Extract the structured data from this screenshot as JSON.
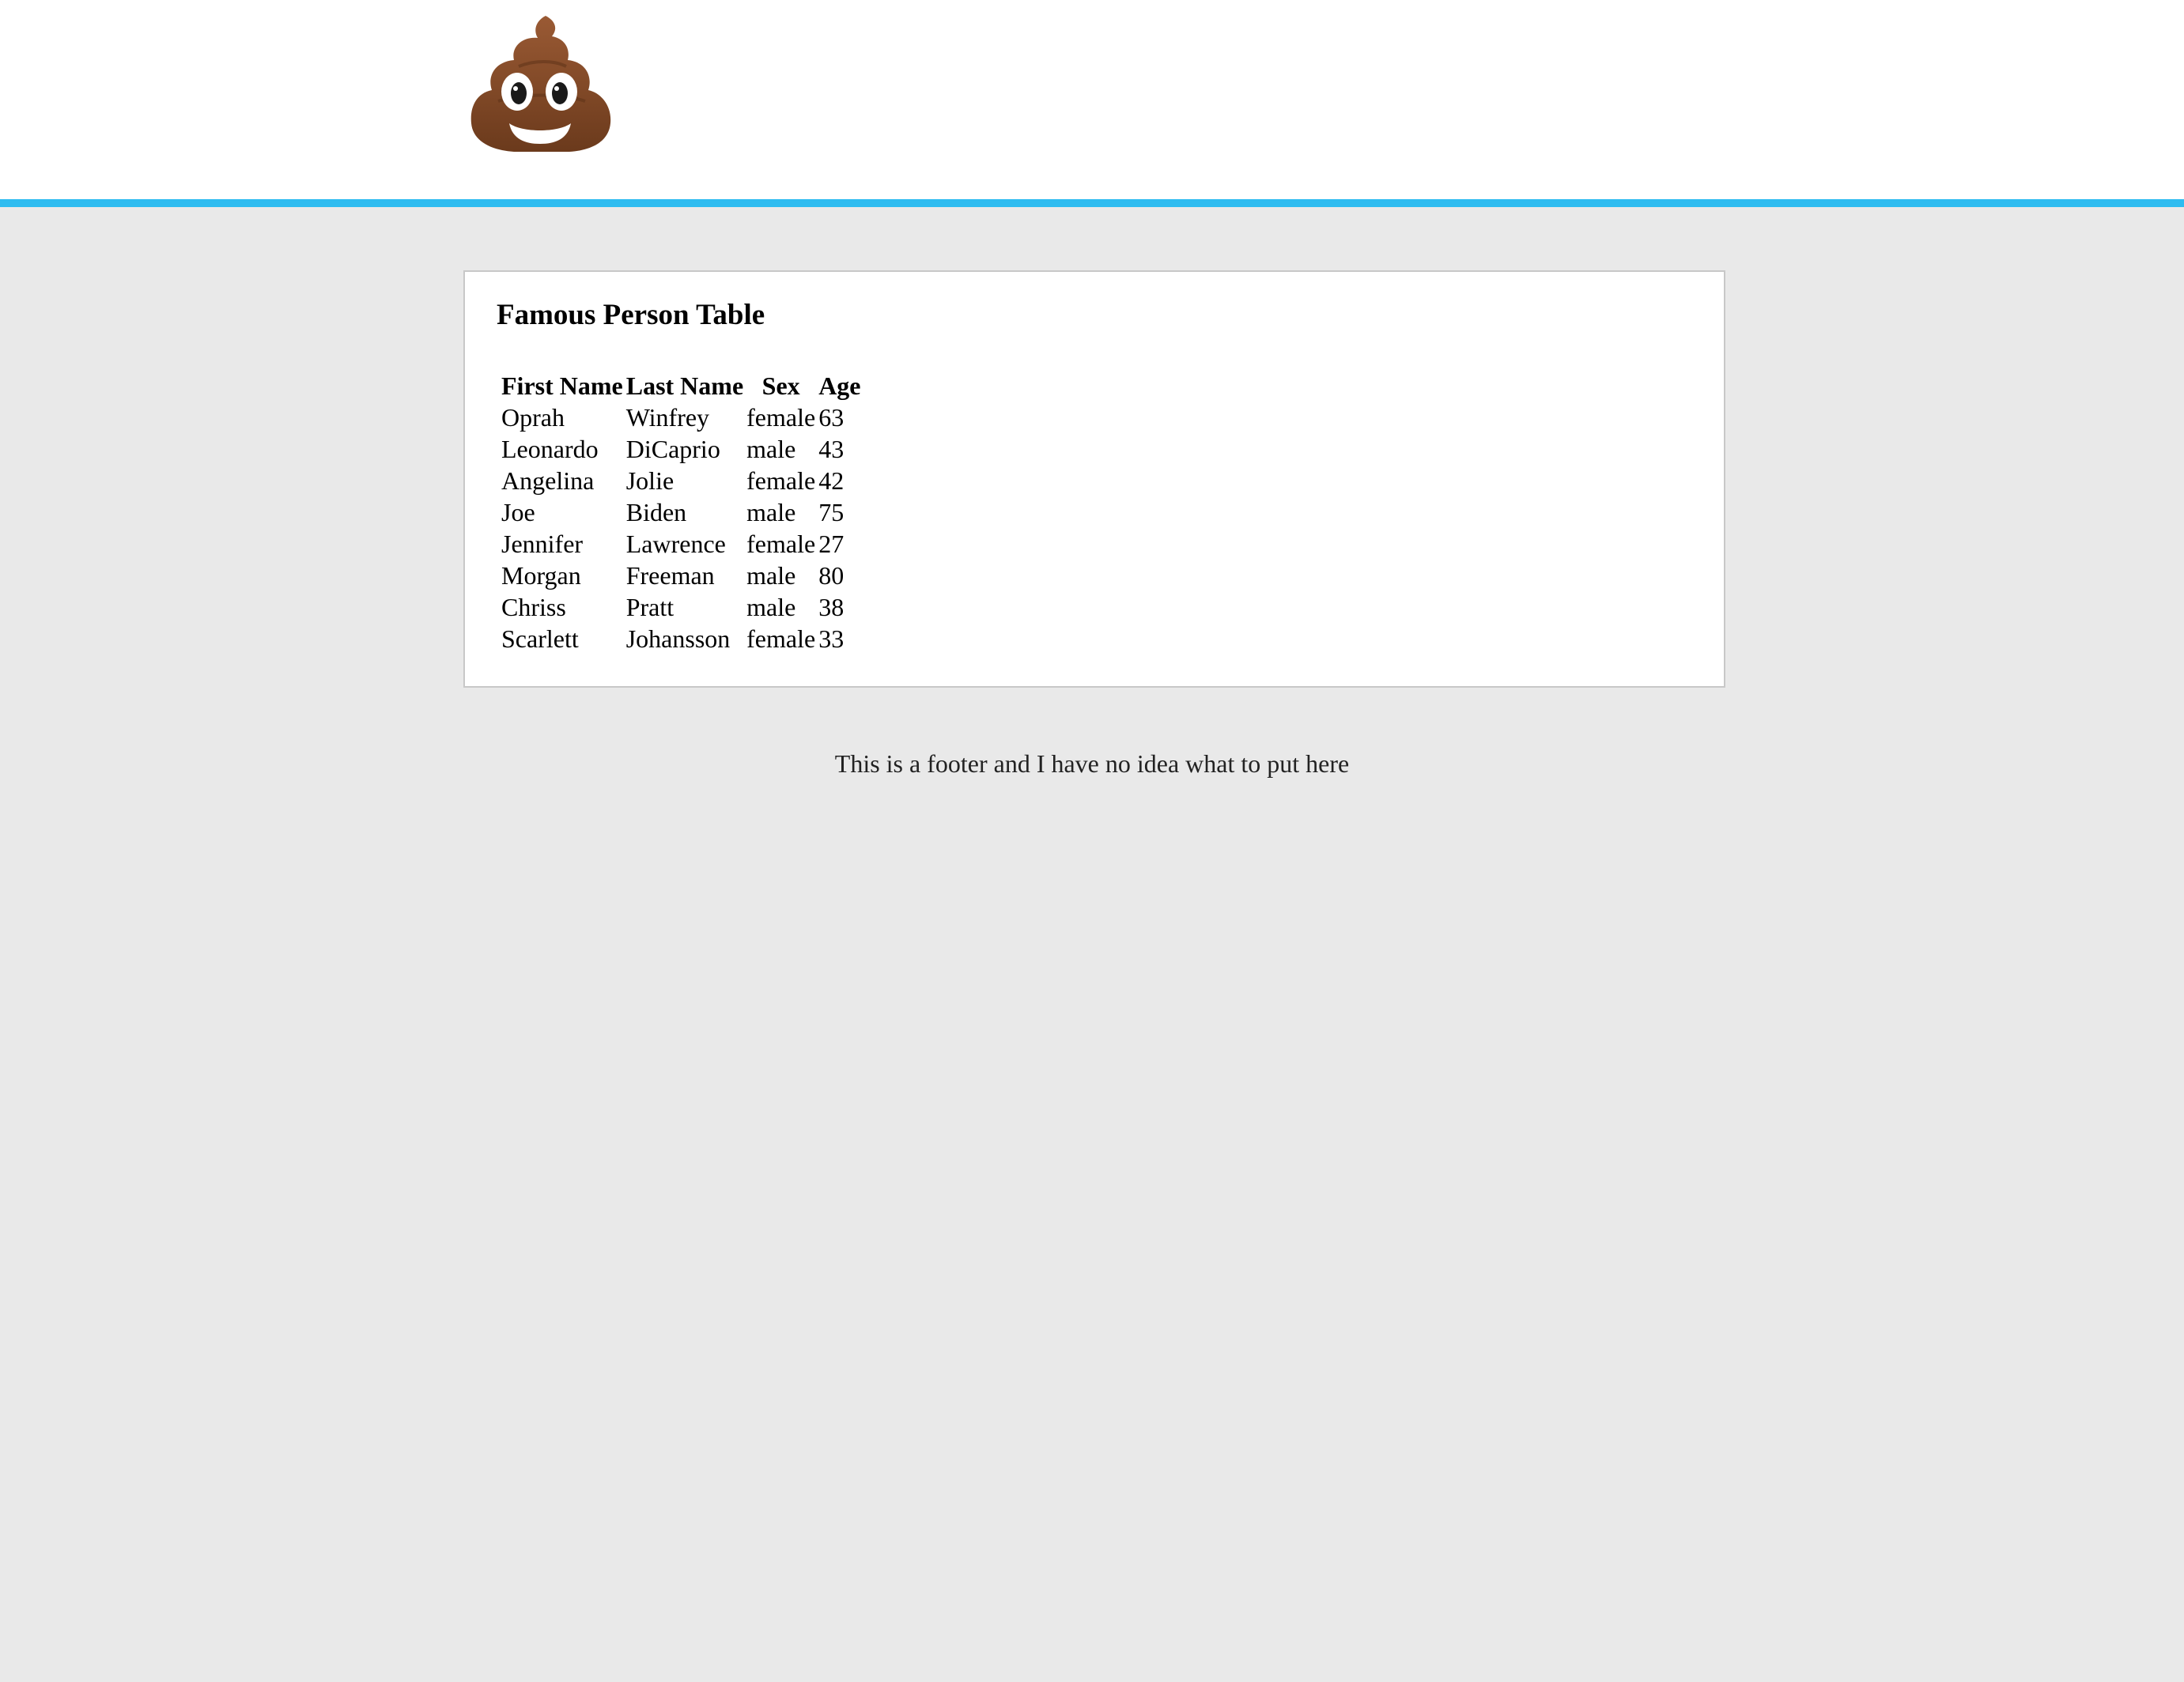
{
  "header": {
    "logo_icon": "pile-of-poo-emoji-icon",
    "accent_color": "#2ebcf0"
  },
  "card": {
    "title": "Famous Person Table",
    "table": {
      "headers": [
        "First Name",
        "Last Name",
        "Sex",
        "Age"
      ],
      "rows": [
        [
          "Oprah",
          "Winfrey",
          "female",
          "63"
        ],
        [
          "Leonardo",
          "DiCaprio",
          "male",
          "43"
        ],
        [
          "Angelina",
          "Jolie",
          "female",
          "42"
        ],
        [
          "Joe",
          "Biden",
          "male",
          "75"
        ],
        [
          "Jennifer",
          "Lawrence",
          "female",
          "27"
        ],
        [
          "Morgan",
          "Freeman",
          "male",
          "80"
        ],
        [
          "Chriss",
          "Pratt",
          "male",
          "38"
        ],
        [
          "Scarlett",
          "Johansson",
          "female",
          "33"
        ]
      ]
    }
  },
  "footer": {
    "text": "This is a footer and I have no idea what to put here"
  },
  "colors": {
    "page_background": "#e9e9e9",
    "header_background": "#ffffff",
    "card_border": "#c8c8c8"
  }
}
